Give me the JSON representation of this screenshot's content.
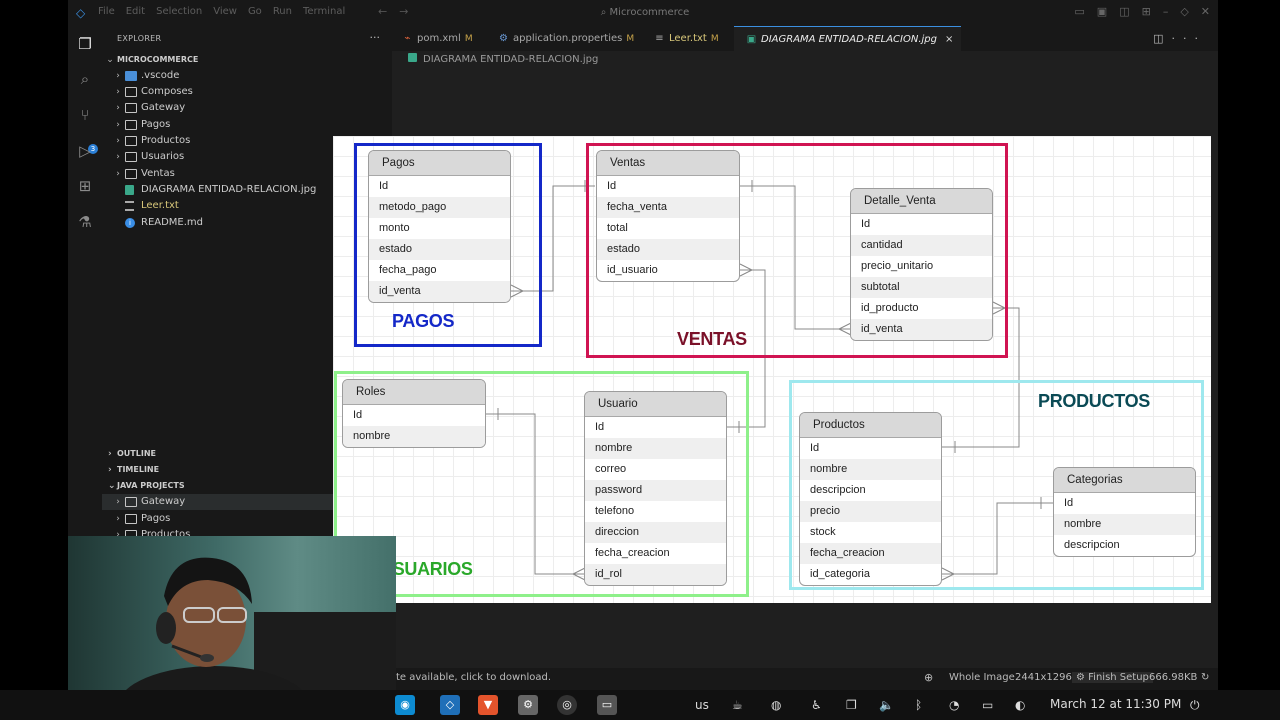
{
  "titlebar": {
    "menu": [
      "File",
      "Edit",
      "Selection",
      "View",
      "Go",
      "Run",
      "Terminal"
    ],
    "search": "Microcommerce"
  },
  "activity_bar": {
    "scm_badge": "3"
  },
  "explorer": {
    "header": "EXPLORER",
    "root": "MICROCOMMERCE",
    "items": [
      {
        "label": ".vscode",
        "kind": "folder"
      },
      {
        "label": "Composes",
        "kind": "folder"
      },
      {
        "label": "Gateway",
        "kind": "folder"
      },
      {
        "label": "Pagos",
        "kind": "folder"
      },
      {
        "label": "Productos",
        "kind": "folder"
      },
      {
        "label": "Usuarios",
        "kind": "folder"
      },
      {
        "label": "Ventas",
        "kind": "folder"
      },
      {
        "label": "DIAGRAMA ENTIDAD-RELACION.jpg",
        "kind": "image"
      },
      {
        "label": "Leer.txt",
        "kind": "text",
        "marker": "M"
      },
      {
        "label": "README.md",
        "kind": "info"
      }
    ],
    "sections": [
      "OUTLINE",
      "TIMELINE",
      "JAVA PROJECTS"
    ],
    "java_projects": [
      "Gateway",
      "Pagos",
      "Productos"
    ]
  },
  "tabs": [
    {
      "label": "pom.xml",
      "marker": "M",
      "icon": "rss-icon"
    },
    {
      "label": "application.properties",
      "marker": "M",
      "icon": "gear-icon"
    },
    {
      "label": "Leer.txt",
      "marker": "M",
      "icon": "lines-icon"
    },
    {
      "label": "DIAGRAMA ENTIDAD-RELACION.jpg",
      "icon": "image-icon",
      "close": "×"
    }
  ],
  "breadcrumb": "DIAGRAMA ENTIDAD-RELACION.jpg",
  "diagram": {
    "regions": {
      "pagos": {
        "label": "PAGOS",
        "color": "#1428c8"
      },
      "ventas": {
        "label": "VENTAS",
        "color": "#d01452",
        "label_color": "#7a1028"
      },
      "usuarios": {
        "label": "USUARIOS",
        "color": "#8ef08a",
        "label_color": "#2aa82a"
      },
      "productos": {
        "label": "PRODUCTOS",
        "color": "#9ee8ee",
        "label_color": "#0a4a55"
      }
    },
    "entities": {
      "pagos": {
        "name": "Pagos",
        "fields": [
          "Id",
          "metodo_pago",
          "monto",
          "estado",
          "fecha_pago",
          "id_venta"
        ]
      },
      "ventas": {
        "name": "Ventas",
        "fields": [
          "Id",
          "fecha_venta",
          "total",
          "estado",
          "id_usuario"
        ]
      },
      "detalle": {
        "name": "Detalle_Venta",
        "fields": [
          "Id",
          "cantidad",
          "precio_unitario",
          "subtotal",
          "id_producto",
          "id_venta"
        ]
      },
      "roles": {
        "name": "Roles",
        "fields": [
          "Id",
          "nombre"
        ]
      },
      "usuario": {
        "name": "Usuario",
        "fields": [
          "Id",
          "nombre",
          "correo",
          "password",
          "telefono",
          "direccion",
          "fecha_creacion",
          "id_rol"
        ]
      },
      "productos": {
        "name": "Productos",
        "fields": [
          "Id",
          "nombre",
          "descripcion",
          "precio",
          "stock",
          "fecha_creacion",
          "id_categoria"
        ]
      },
      "categorias": {
        "name": "Categorias",
        "fields": [
          "Id",
          "nombre",
          "descripcion"
        ]
      }
    }
  },
  "statusbar": {
    "notice": "te available, click to download.",
    "mode": "Whole Image",
    "dimensions": "2441x1296",
    "setup": "Finish Setup",
    "size": "666.98KB"
  },
  "taskbar": {
    "keyboard": "us",
    "clock": "March 12 at 11:30 PM"
  }
}
